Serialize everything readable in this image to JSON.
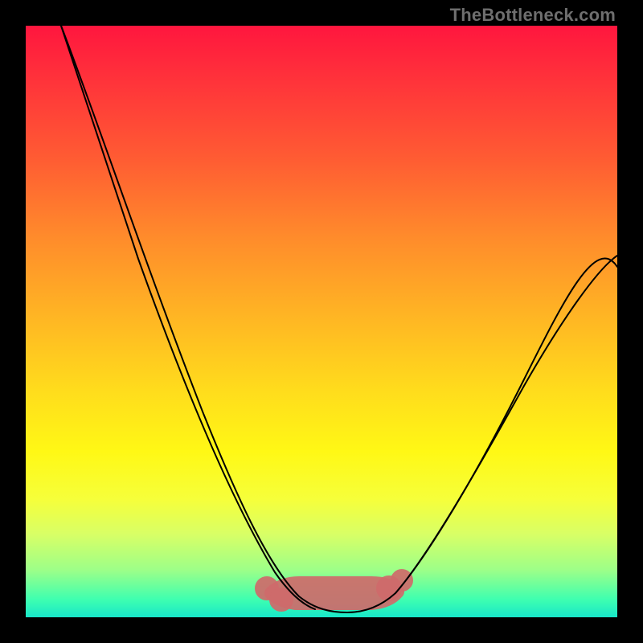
{
  "watermark": {
    "text": "TheBottleneck.com"
  },
  "colors": {
    "frame": "#000000",
    "gradient_stops": [
      "#ff163e",
      "#ff2f3b",
      "#ff5a33",
      "#ff8c2b",
      "#ffb823",
      "#ffdd1c",
      "#fff815",
      "#f6ff3a",
      "#d8ff66",
      "#9dff88",
      "#3effb0",
      "#18e7c9"
    ],
    "curve": "#000000",
    "bottom_marker": "#cf6b6b"
  },
  "chart_data": {
    "type": "line",
    "title": "",
    "xlabel": "",
    "ylabel": "",
    "xlim": [
      0,
      100
    ],
    "ylim": [
      0,
      100
    ],
    "note": "Axes are unitless; values are estimated from pixel positions. y is plotted with 0 at the bottom (green) and 100 at the top (red). The curve is a V/valley shape whose floor sits near y≈2 around x≈45–58.",
    "series": [
      {
        "name": "bottleneck-curve",
        "x": [
          6,
          12,
          18,
          24,
          30,
          35,
          40,
          44,
          48,
          52,
          56,
          60,
          66,
          72,
          78,
          84,
          90,
          96,
          100
        ],
        "y": [
          100,
          86,
          72,
          58,
          44,
          31,
          18,
          8,
          3,
          2,
          3,
          8,
          18,
          30,
          41,
          51,
          58,
          60,
          61
        ]
      }
    ],
    "markers": [
      {
        "name": "valley-highlight",
        "shape": "rounded-segment",
        "x_range": [
          42,
          60
        ],
        "y": 2
      }
    ]
  }
}
